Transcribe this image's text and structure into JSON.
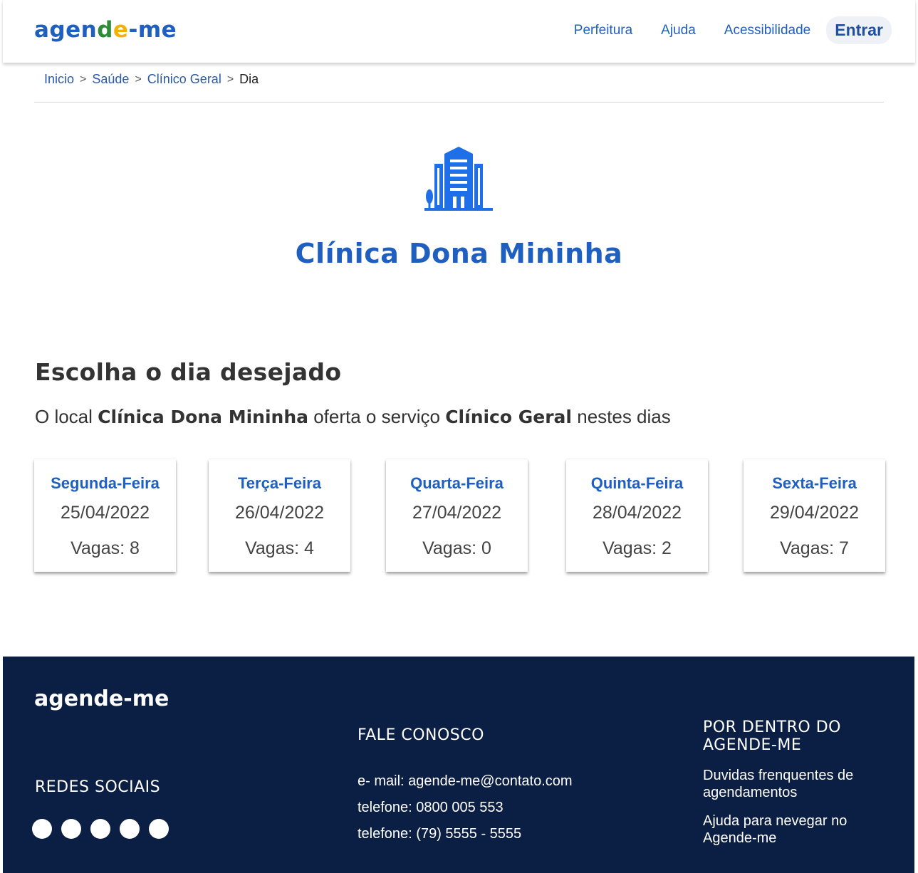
{
  "header": {
    "logo": {
      "part1": "agen",
      "part2": "d",
      "part3": "e",
      "part4": "-me"
    },
    "nav": [
      "Perfeitura",
      "Ajuda",
      "Acessibilidade"
    ],
    "login_label": "Entrar"
  },
  "breadcrumb": {
    "items": [
      "Inicio",
      "Saúde",
      "Clínico Geral"
    ],
    "current": "Dia",
    "separator": ">"
  },
  "clinic": {
    "icon": "building-icon",
    "name": "Clínica Dona Mininha",
    "accent": "#1f5fbf"
  },
  "selection": {
    "title": "Escolha o dia desejado",
    "desc_prefix": "O local",
    "desc_place": "Clínica Dona Mininha",
    "desc_middle": "oferta o serviço",
    "desc_service": "Clínico Geral",
    "desc_suffix": "nestes dias"
  },
  "days": [
    {
      "day": "Segunda-Feira",
      "date": "25/04/2022",
      "vagas": "Vagas: 8"
    },
    {
      "day": "Terça-Feira",
      "date": "26/04/2022",
      "vagas": "Vagas: 4"
    },
    {
      "day": "Quarta-Feira",
      "date": "27/04/2022",
      "vagas": "Vagas: 0"
    },
    {
      "day": "Quinta-Feira",
      "date": "28/04/2022",
      "vagas": "Vagas: 2"
    },
    {
      "day": "Sexta-Feira",
      "date": "29/04/2022",
      "vagas": "Vagas: 7"
    }
  ],
  "footer": {
    "logo": "agende-me",
    "redes_title": "REDES SOCIAIS",
    "fale_title": "FALE CONOSCO",
    "contact": [
      "e- mail: agende-me@contato.com",
      "telefone: 0800 005 553",
      "telefone: (79) 5555 - 5555"
    ],
    "por_title": "POR DENTRO DO AGENDE-ME",
    "links": [
      "Duvidas frenquentes de agendamentos",
      "Ajuda para nevegar no Agende-me"
    ],
    "background": "#0b1e44"
  }
}
